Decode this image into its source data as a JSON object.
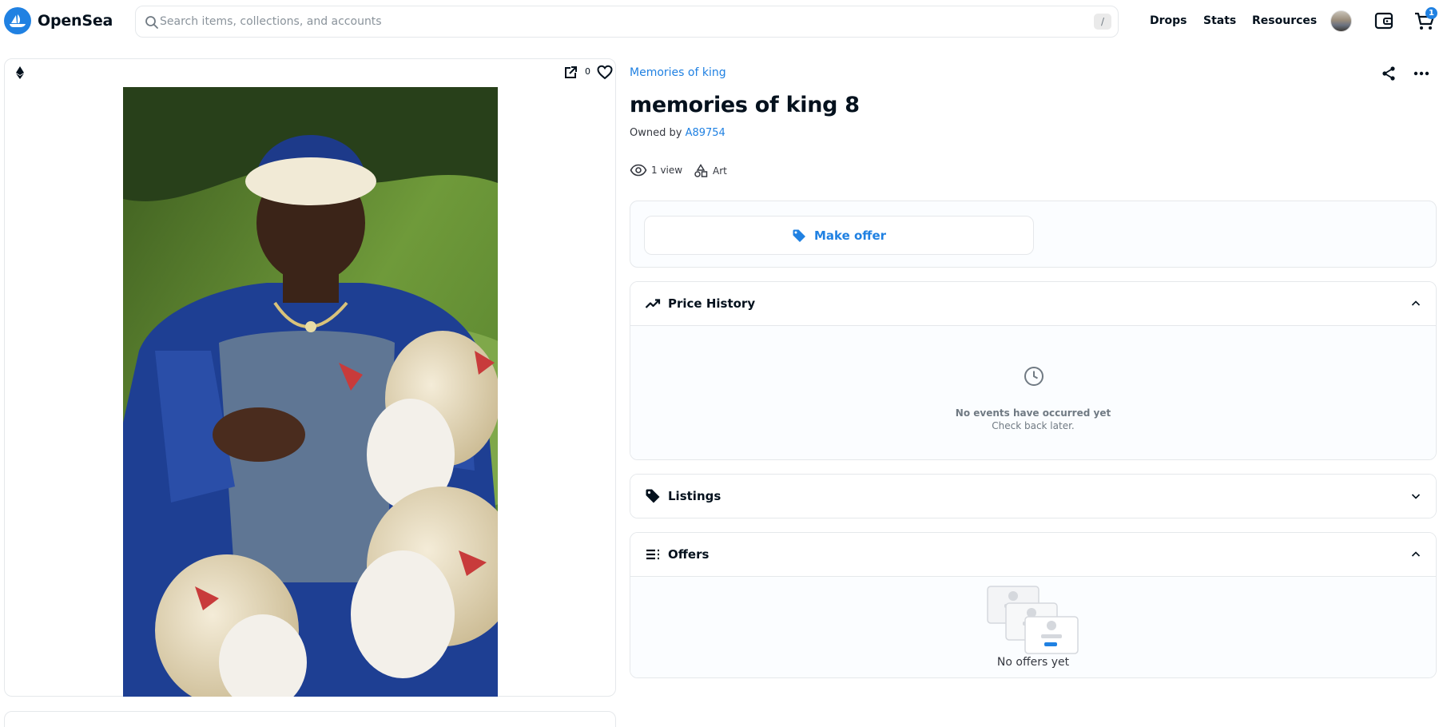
{
  "brand": {
    "name": "OpenSea",
    "accent": "#2081e2"
  },
  "search": {
    "placeholder": "Search items, collections, and accounts",
    "shortcut": "/"
  },
  "nav": {
    "drops": "Drops",
    "stats": "Stats",
    "resources": "Resources"
  },
  "cart": {
    "count": "1"
  },
  "media": {
    "favorites": "0",
    "chain_icon": "ethereum-icon",
    "artwork": "nft-artwork-portrait-with-sheep"
  },
  "item": {
    "collection": "Memories of king",
    "title": "memories of king 8",
    "owned_by_label": "Owned by",
    "owner": "A89754",
    "views": "1 view",
    "category": "Art"
  },
  "actions": {
    "make_offer": "Make offer"
  },
  "price_history": {
    "title": "Price History",
    "empty_title": "No events have occurred yet",
    "empty_subtitle": "Check back later."
  },
  "listings": {
    "title": "Listings"
  },
  "offers": {
    "title": "Offers",
    "empty": "No offers yet"
  }
}
